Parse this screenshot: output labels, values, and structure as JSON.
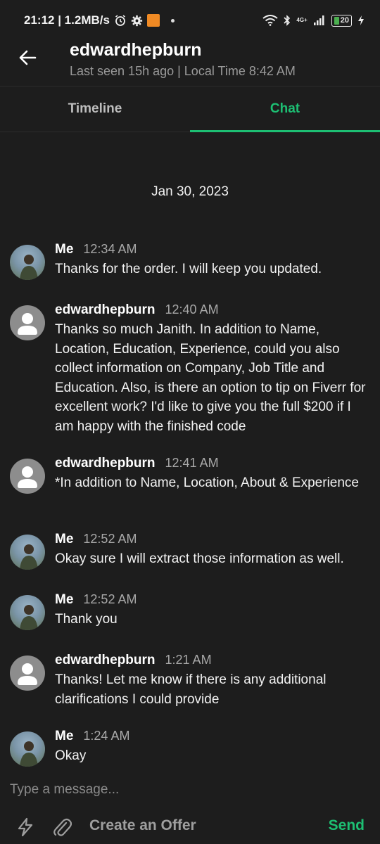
{
  "status_bar": {
    "time_speed": "21:12 | 1.2MB/s",
    "network": "4G+",
    "battery": "20"
  },
  "header": {
    "title": "edwardhepburn",
    "subtitle": "Last seen 15h ago | Local Time 8:42 AM"
  },
  "tabs": [
    {
      "label": "Timeline",
      "active": false
    },
    {
      "label": "Chat",
      "active": true
    }
  ],
  "date_separator": "Jan 30, 2023",
  "messages": [
    {
      "sender": "Me",
      "time": "12:34 AM",
      "text": "Thanks for the order. I will keep you updated.",
      "avatar": "photo"
    },
    {
      "sender": "edwardhepburn",
      "time": "12:40 AM",
      "text": "Thanks so much Janith. In addition to Name, Location, Education, Experience, could you also collect information on Company, Job Title and Education. Also, is there an option to tip on Fiverr for excellent work? I'd like to give you the full $200 if I am happy with the finished code",
      "avatar": "default"
    },
    {
      "sender": "edwardhepburn",
      "time": "12:41 AM",
      "text": "*In addition to Name, Location, About & Experience",
      "avatar": "default"
    },
    {
      "sender": "Me",
      "time": "12:52 AM",
      "text": "Okay sure I will extract those information as well.",
      "avatar": "photo"
    },
    {
      "sender": "Me",
      "time": "12:52 AM",
      "text": "Thank you",
      "avatar": "photo"
    },
    {
      "sender": "edwardhepburn",
      "time": "1:21 AM",
      "text": "Thanks! Let me know if there is any additional clarifications I could provide",
      "avatar": "default"
    },
    {
      "sender": "Me",
      "time": "1:24 AM",
      "text": "Okay",
      "avatar": "photo"
    }
  ],
  "composer": {
    "placeholder": "Type a message...",
    "offer_label": "Create an Offer",
    "send_label": "Send"
  },
  "colors": {
    "background": "#1d1d1d",
    "accent": "#1dbf73",
    "muted_text": "#9a9a9a"
  },
  "icons": [
    "back-arrow-icon",
    "alarm-icon",
    "settings-icon",
    "wifi-icon",
    "bluetooth-icon",
    "signal-icon",
    "battery-icon",
    "charging-icon",
    "quick-response-icon",
    "attachment-icon"
  ]
}
